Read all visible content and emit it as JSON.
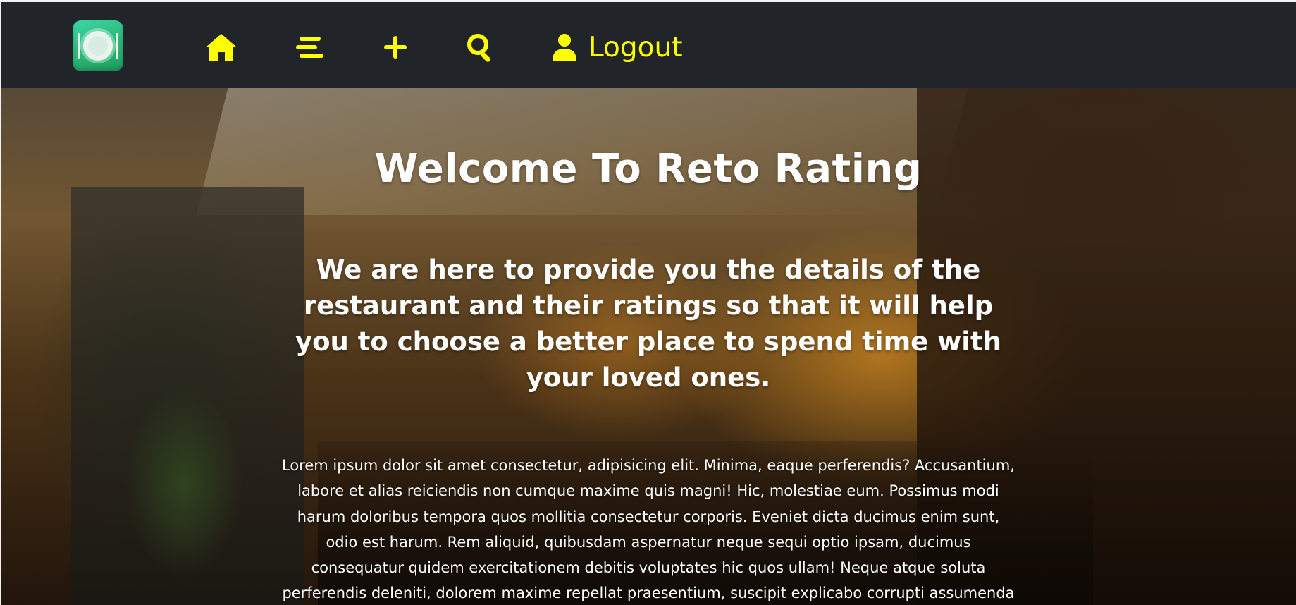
{
  "navbar": {
    "logo_icon": "restaurant-plate-logo-icon",
    "accent_color": "#ffff00",
    "background_color": "#212529",
    "items": [
      {
        "icon": "home-icon"
      },
      {
        "icon": "menu-lines-icon"
      },
      {
        "icon": "plus-icon"
      },
      {
        "icon": "search-icon"
      },
      {
        "icon": "user-icon",
        "label": "Logout"
      }
    ]
  },
  "hero": {
    "title": "Welcome To Reto Rating",
    "subtitle": "We are here to provide you the details of the restaurant and their ratings so that it will help you to choose a better place to spend time with your loved ones.",
    "body": "Lorem ipsum dolor sit amet consectetur, adipisicing elit. Minima, eaque perferendis? Accusantium, labore et alias reiciendis non cumque maxime quis magni! Hic, molestiae eum. Possimus modi harum doloribus tempora quos mollitia consectetur corporis. Eveniet dicta ducimus enim sunt, odio est harum. Rem aliquid, quibusdam aspernatur neque sequi optio ipsam, ducimus consequatur quidem exercitationem debitis voluptates hic quos ullam! Neque atque soluta perferendis deleniti, dolorem maxime repellat praesentium, suscipit explicabo corrupti assumenda"
  }
}
